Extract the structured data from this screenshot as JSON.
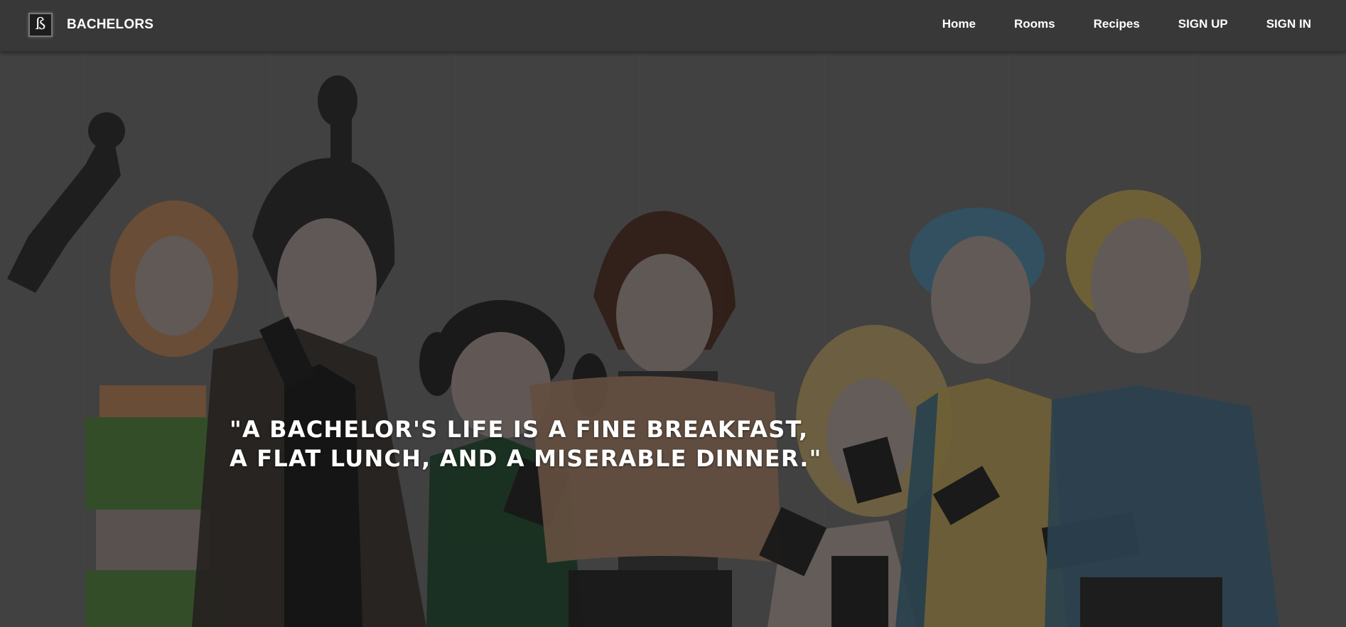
{
  "navbar": {
    "logo_glyph": "ß",
    "brand": "BACHELORS",
    "links": [
      {
        "label": "Home"
      },
      {
        "label": "Rooms"
      },
      {
        "label": "Recipes"
      },
      {
        "label": "SIGN UP"
      },
      {
        "label": "SIGN IN"
      }
    ]
  },
  "hero": {
    "image_description": "anime-style group illustration of seven young people",
    "quote_line1": "\"A BACHELOR'S LIFE IS A FINE BREAKFAST,",
    "quote_line2": "A FLAT LUNCH, AND A MISERABLE DINNER.\""
  },
  "colors": {
    "navbar_bg": "#383838",
    "hero_overlay": "#4a4a4a",
    "text": "#ffffff"
  }
}
